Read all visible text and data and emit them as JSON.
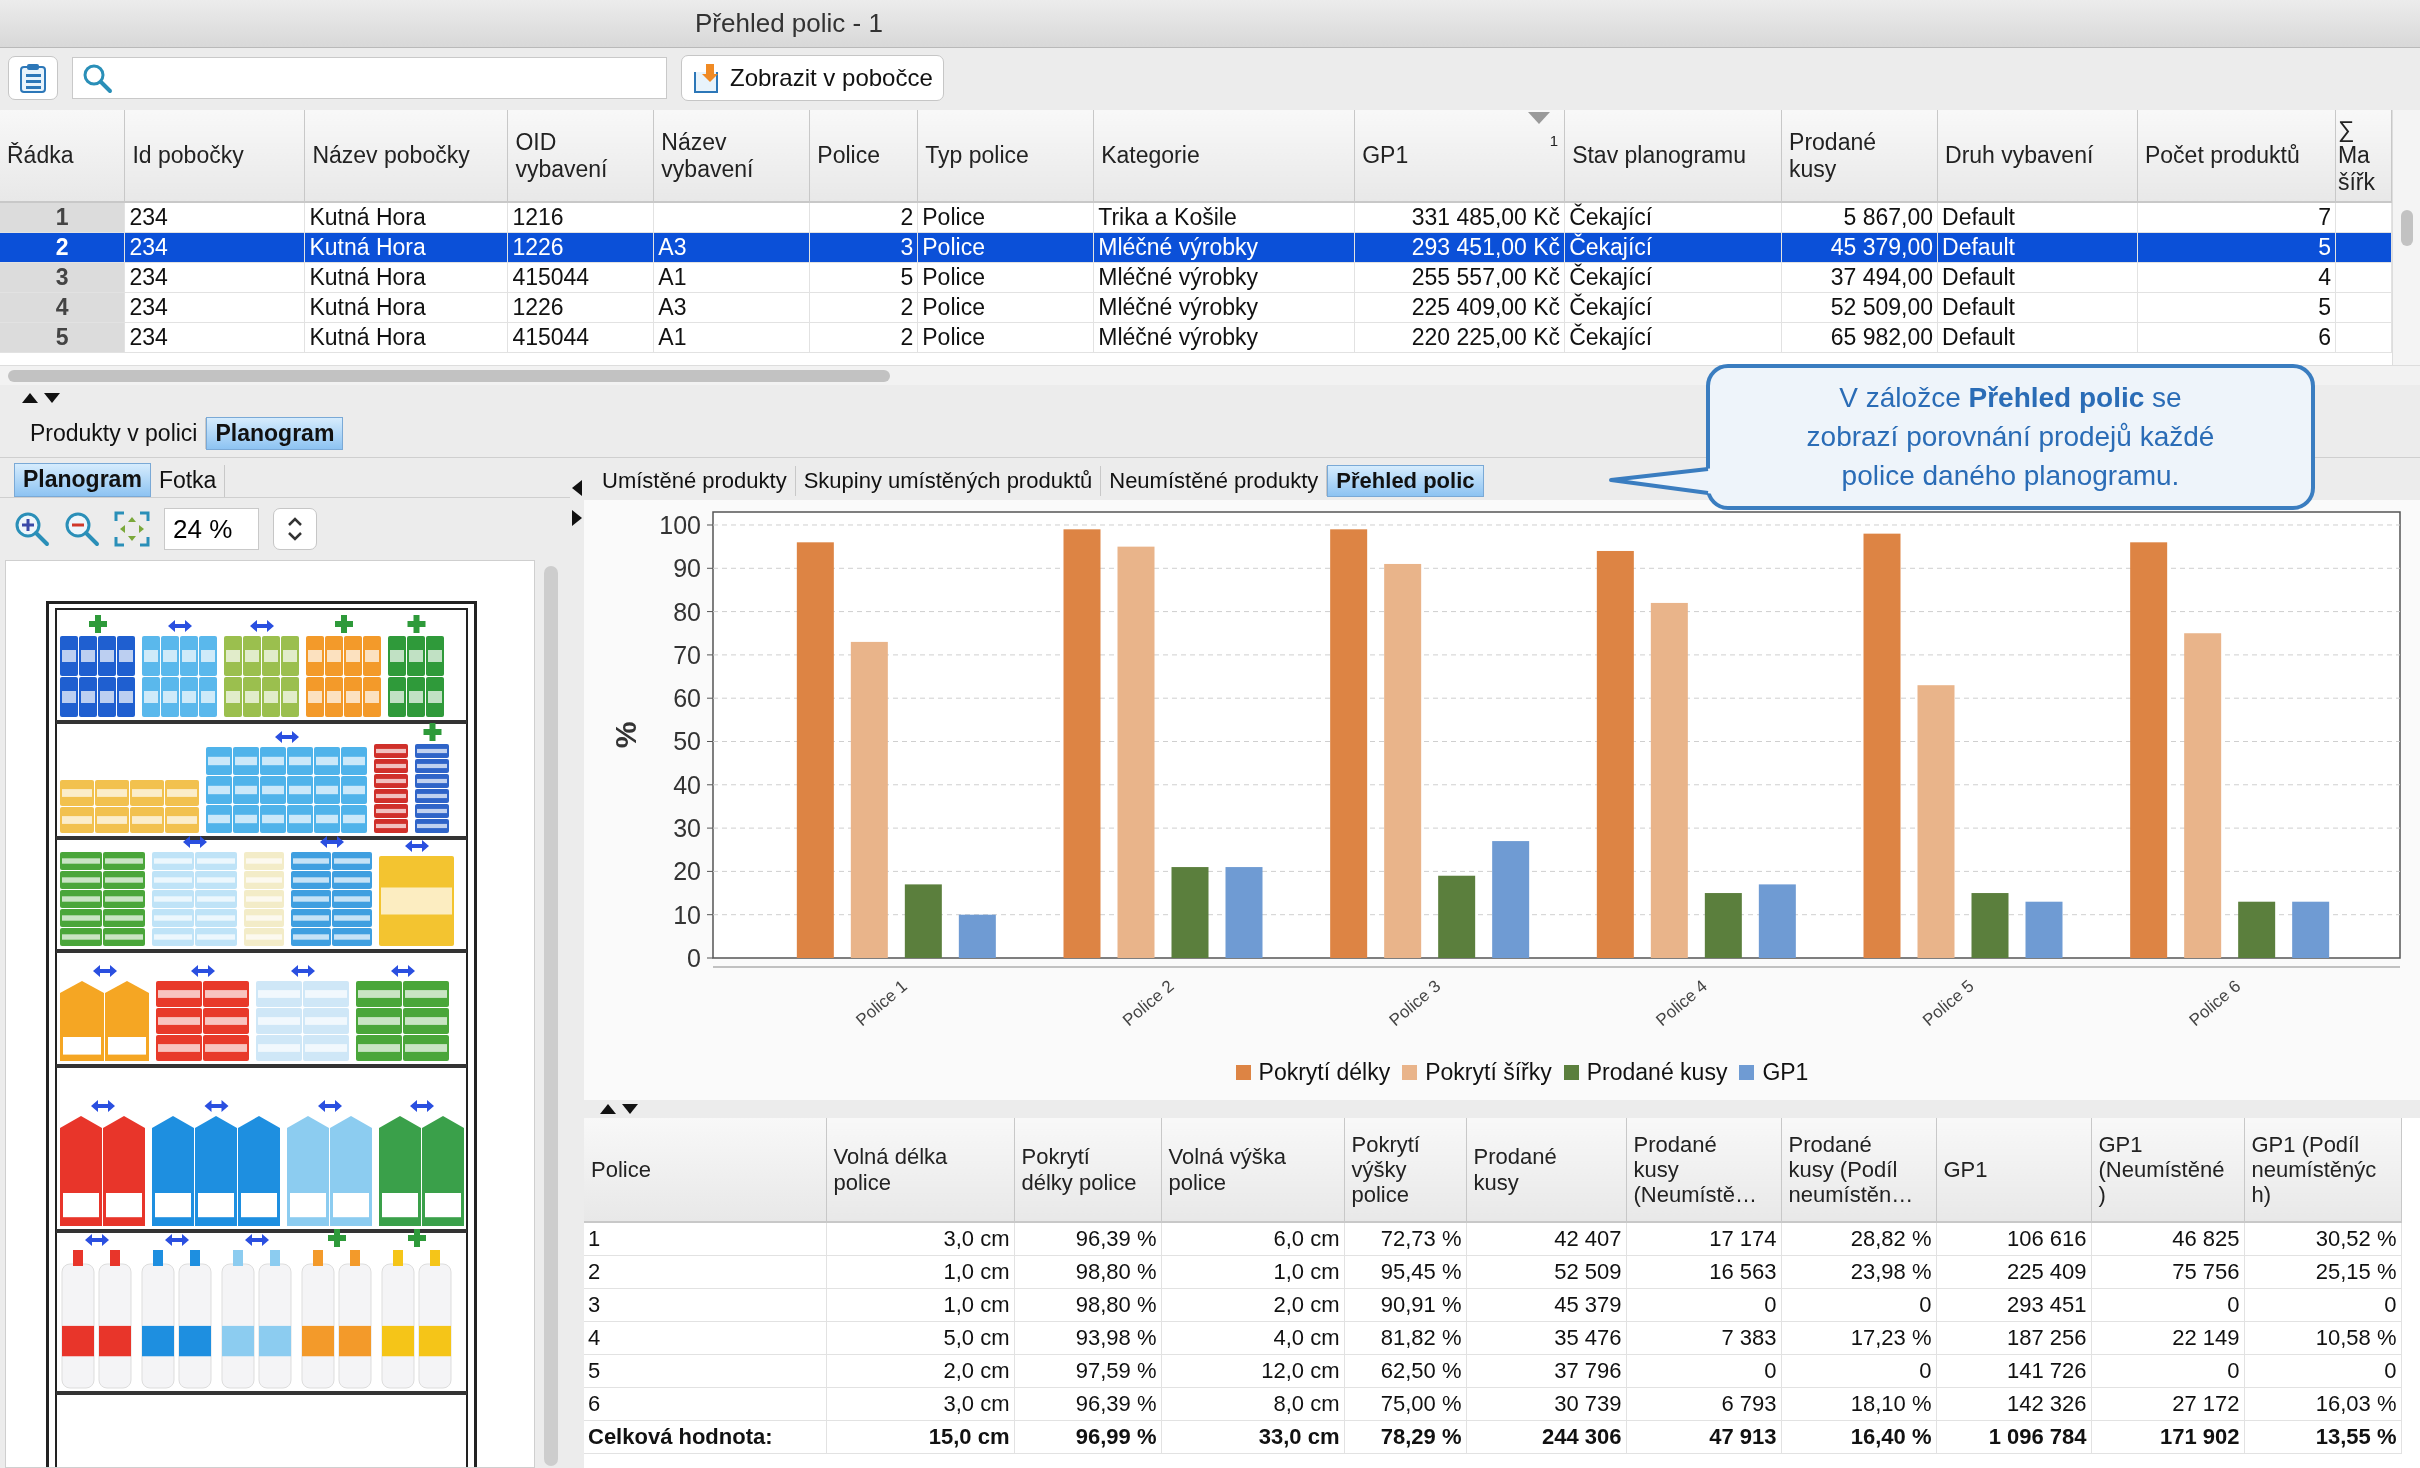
{
  "window": {
    "title": "Přehled polic - 1"
  },
  "toolbar": {
    "show_button": {
      "label": "Zobrazit v pobočce"
    }
  },
  "main_table": {
    "columns": [
      {
        "label": "Řádka"
      },
      {
        "label": "Id pobočky"
      },
      {
        "label": "Název pobočky"
      },
      {
        "label": "OID\nvybavení"
      },
      {
        "label": "Název\nvybavení"
      },
      {
        "label": "Police"
      },
      {
        "label": "Typ police"
      },
      {
        "label": "Kategorie"
      },
      {
        "label": "GP1",
        "sort_order": "1"
      },
      {
        "label": "Stav planogramu"
      },
      {
        "label": "Prodané\nkusy"
      },
      {
        "label": "Druh vybavení"
      },
      {
        "label": "Počet produktů"
      },
      {
        "label": "∑ Ma\nšířk"
      }
    ],
    "rows": [
      {
        "row_no": "1",
        "branch_id": "234",
        "branch_name": "Kutná Hora",
        "equipment_oid": "1216",
        "shelf": "2",
        "shelf_type": "Police",
        "category": "Trika a Košile",
        "gp1": "331 485,00 Kč",
        "planogram_state": "Čekající",
        "sold_units": "5 867,00",
        "equipment_kind": "Default",
        "product_count": "7",
        "selected": false
      },
      {
        "row_no": "2",
        "branch_id": "234",
        "branch_name": "Kutná Hora",
        "equipment_oid": "1226",
        "equipment_name": "A3",
        "shelf": "3",
        "shelf_type": "Police",
        "category": "Mléčné výrobky",
        "gp1": "293 451,00 Kč",
        "planogram_state": "Čekající",
        "sold_units": "45 379,00",
        "equipment_kind": "Default",
        "product_count": "5",
        "selected": true
      },
      {
        "row_no": "3",
        "branch_id": "234",
        "branch_name": "Kutná Hora",
        "equipment_oid": "415044",
        "equipment_name": "A1",
        "shelf": "5",
        "shelf_type": "Police",
        "category": "Mléčné výrobky",
        "gp1": "255 557,00 Kč",
        "planogram_state": "Čekající",
        "sold_units": "37 494,00",
        "equipment_kind": "Default",
        "product_count": "4",
        "selected": false
      },
      {
        "row_no": "4",
        "branch_id": "234",
        "branch_name": "Kutná Hora",
        "equipment_oid": "1226",
        "equipment_name": "A3",
        "shelf": "2",
        "shelf_type": "Police",
        "category": "Mléčné výrobky",
        "gp1": "225 409,00 Kč",
        "planogram_state": "Čekající",
        "sold_units": "52 509,00",
        "equipment_kind": "Default",
        "product_count": "5",
        "selected": false
      },
      {
        "row_no": "5",
        "branch_id": "234",
        "branch_name": "Kutná Hora",
        "equipment_oid": "415044",
        "equipment_name": "A1",
        "shelf": "2",
        "shelf_type": "Police",
        "category": "Mléčné výrobky",
        "gp1": "220 225,00 Kč",
        "planogram_state": "Čekající",
        "sold_units": "65 982,00",
        "equipment_kind": "Default",
        "product_count": "6",
        "selected": false
      }
    ]
  },
  "detail_tabs": [
    {
      "label": "Produkty v polici",
      "selected": false
    },
    {
      "label": "Planogram",
      "selected": true
    }
  ],
  "planogram_panel": {
    "tabs": [
      {
        "label": "Planogram",
        "selected": true
      },
      {
        "label": "Fotka",
        "selected": false
      }
    ],
    "zoom": {
      "value": "24 %"
    }
  },
  "chart_panel": {
    "tabs": [
      {
        "label": "Umístěné produkty",
        "selected": false
      },
      {
        "label": "Skupiny umístěných produktů",
        "selected": false
      },
      {
        "label": "Neumístěné produkty",
        "selected": false
      },
      {
        "label": "Přehled polic",
        "selected": true
      }
    ],
    "chart_data": {
      "type": "bar",
      "ylabel": "%",
      "categories": [
        "Police 1",
        "Police 2",
        "Police 3",
        "Police 4",
        "Police 5",
        "Police 6"
      ],
      "ylim": [
        0,
        103
      ],
      "yticks": [
        0,
        10,
        20,
        30,
        40,
        50,
        60,
        70,
        80,
        90,
        100
      ],
      "grid": true,
      "series": [
        {
          "name": "Pokrytí délky",
          "color": "#dd8444",
          "values": [
            96,
            99,
            99,
            94,
            98,
            96
          ]
        },
        {
          "name": "Pokrytí šířky",
          "color": "#e9b48a",
          "values": [
            73,
            95,
            91,
            82,
            63,
            75
          ]
        },
        {
          "name": "Prodané kusy",
          "color": "#5b7f3d",
          "values": [
            17,
            21,
            19,
            15,
            15,
            13
          ]
        },
        {
          "name": "GP1",
          "color": "#6f9bd3",
          "values": [
            10,
            21,
            27,
            17,
            13,
            13
          ]
        }
      ]
    }
  },
  "callout": {
    "text": "V záložce **Přehled polic** se zobrazí porovnání prodejů každé police daného planogramu."
  },
  "shelf_table": {
    "columns": [
      "Police",
      "Volná délka\npolice",
      "Pokrytí\ndélky police",
      "Volná výška\npolice",
      "Pokrytí\nvýšky\npolice",
      "Prodané\nkusy",
      "Prodané\nkusy\n(Neumístě…",
      "Prodané\nkusy (Podíl\nneumístěn…",
      "GP1",
      "GP1\n(Neumístěné\n)",
      "GP1 (Podíl\nneumístěnýc\nh)"
    ],
    "rows": [
      {
        "kind": "shelf",
        "cells": [
          "1",
          "3,0 cm",
          "96,39 %",
          "6,0 cm",
          "72,73 %",
          "42 407",
          "17 174",
          "28,82 %",
          "106 616",
          "46 825",
          "30,52 %"
        ]
      },
      {
        "kind": "shelf",
        "cells": [
          "2",
          "1,0 cm",
          "98,80 %",
          "1,0 cm",
          "95,45 %",
          "52 509",
          "16 563",
          "23,98 %",
          "225 409",
          "75 756",
          "25,15 %"
        ]
      },
      {
        "kind": "shelf",
        "cells": [
          "3",
          "1,0 cm",
          "98,80 %",
          "2,0 cm",
          "90,91 %",
          "45 379",
          "0",
          "0",
          "293 451",
          "0",
          "0"
        ]
      },
      {
        "kind": "shelf",
        "cells": [
          "4",
          "5,0 cm",
          "93,98 %",
          "4,0 cm",
          "81,82 %",
          "35 476",
          "7 383",
          "17,23 %",
          "187 256",
          "22 149",
          "10,58 %"
        ]
      },
      {
        "kind": "shelf",
        "cells": [
          "5",
          "2,0 cm",
          "97,59 %",
          "12,0 cm",
          "62,50 %",
          "37 796",
          "0",
          "0",
          "141 726",
          "0",
          "0"
        ]
      },
      {
        "kind": "shelf",
        "cells": [
          "6",
          "3,0 cm",
          "96,39 %",
          "8,0 cm",
          "75,00 %",
          "30 739",
          "6 793",
          "18,10 %",
          "142 326",
          "27 172",
          "16,03 %"
        ]
      },
      {
        "kind": "total",
        "cells": [
          "Celková hodnota:",
          "15,0 cm",
          "96,99 %",
          "33,0 cm",
          "78,29 %",
          "244 306",
          "47 913",
          "16,40 %",
          "1 096 784",
          "171 902",
          "13,55 %"
        ]
      }
    ]
  }
}
